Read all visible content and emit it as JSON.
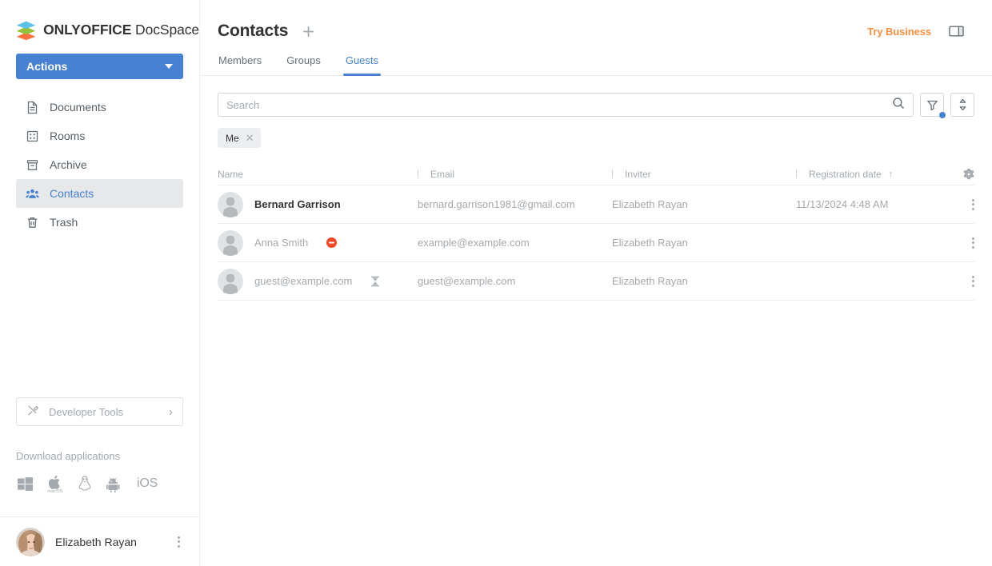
{
  "sidebar": {
    "logo": {
      "brand_bold": "ONLYOFFICE",
      "brand_light": " DocSpace"
    },
    "actions_button": "Actions",
    "items": [
      {
        "label": "Documents",
        "icon": "document-icon",
        "active": false
      },
      {
        "label": "Rooms",
        "icon": "rooms-icon",
        "active": false
      },
      {
        "label": "Archive",
        "icon": "archive-icon",
        "active": false
      },
      {
        "label": "Contacts",
        "icon": "contacts-icon",
        "active": true
      },
      {
        "label": "Trash",
        "icon": "trash-icon",
        "active": false
      }
    ],
    "developer_tools": "Developer Tools",
    "download_title": "Download applications",
    "download_apps": [
      {
        "name": "windows-icon",
        "label": ""
      },
      {
        "name": "macos-icon",
        "label": "macOS"
      },
      {
        "name": "linux-icon",
        "label": ""
      },
      {
        "name": "android-icon",
        "label": ""
      },
      {
        "name": "ios-icon",
        "label": "iOS"
      }
    ],
    "profile_name": "Elizabeth Rayan"
  },
  "header": {
    "title": "Contacts",
    "try_business": "Try Business"
  },
  "tabs": [
    {
      "label": "Members",
      "active": false
    },
    {
      "label": "Groups",
      "active": false
    },
    {
      "label": "Guests",
      "active": true
    }
  ],
  "search": {
    "placeholder": "Search",
    "value": ""
  },
  "filter_chips": [
    {
      "label": "Me"
    }
  ],
  "table": {
    "columns": [
      {
        "label": "Name",
        "sorted": false
      },
      {
        "label": "Email",
        "sorted": false
      },
      {
        "label": "Inviter",
        "sorted": false
      },
      {
        "label": "Registration date",
        "sorted": true,
        "sort_arrow": "↑"
      }
    ],
    "rows": [
      {
        "name": "Bernard Garrison",
        "name_muted": false,
        "status": "none",
        "email": "bernard.garrison1981@gmail.com",
        "inviter": "Elizabeth Rayan",
        "registration_date": "11/13/2024 4:48 AM"
      },
      {
        "name": "Anna Smith",
        "name_muted": true,
        "status": "disabled",
        "email": "example@example.com",
        "inviter": "Elizabeth Rayan",
        "registration_date": ""
      },
      {
        "name": "guest@example.com",
        "name_muted": true,
        "status": "pending",
        "email": "guest@example.com",
        "inviter": "Elizabeth Rayan",
        "registration_date": ""
      }
    ]
  },
  "colors": {
    "accent_blue": "#4781d1",
    "orange": "#ff8f40",
    "muted_gray": "#a3a9ae",
    "status_disabled_red": "#f24724",
    "border": "#eceef1"
  }
}
